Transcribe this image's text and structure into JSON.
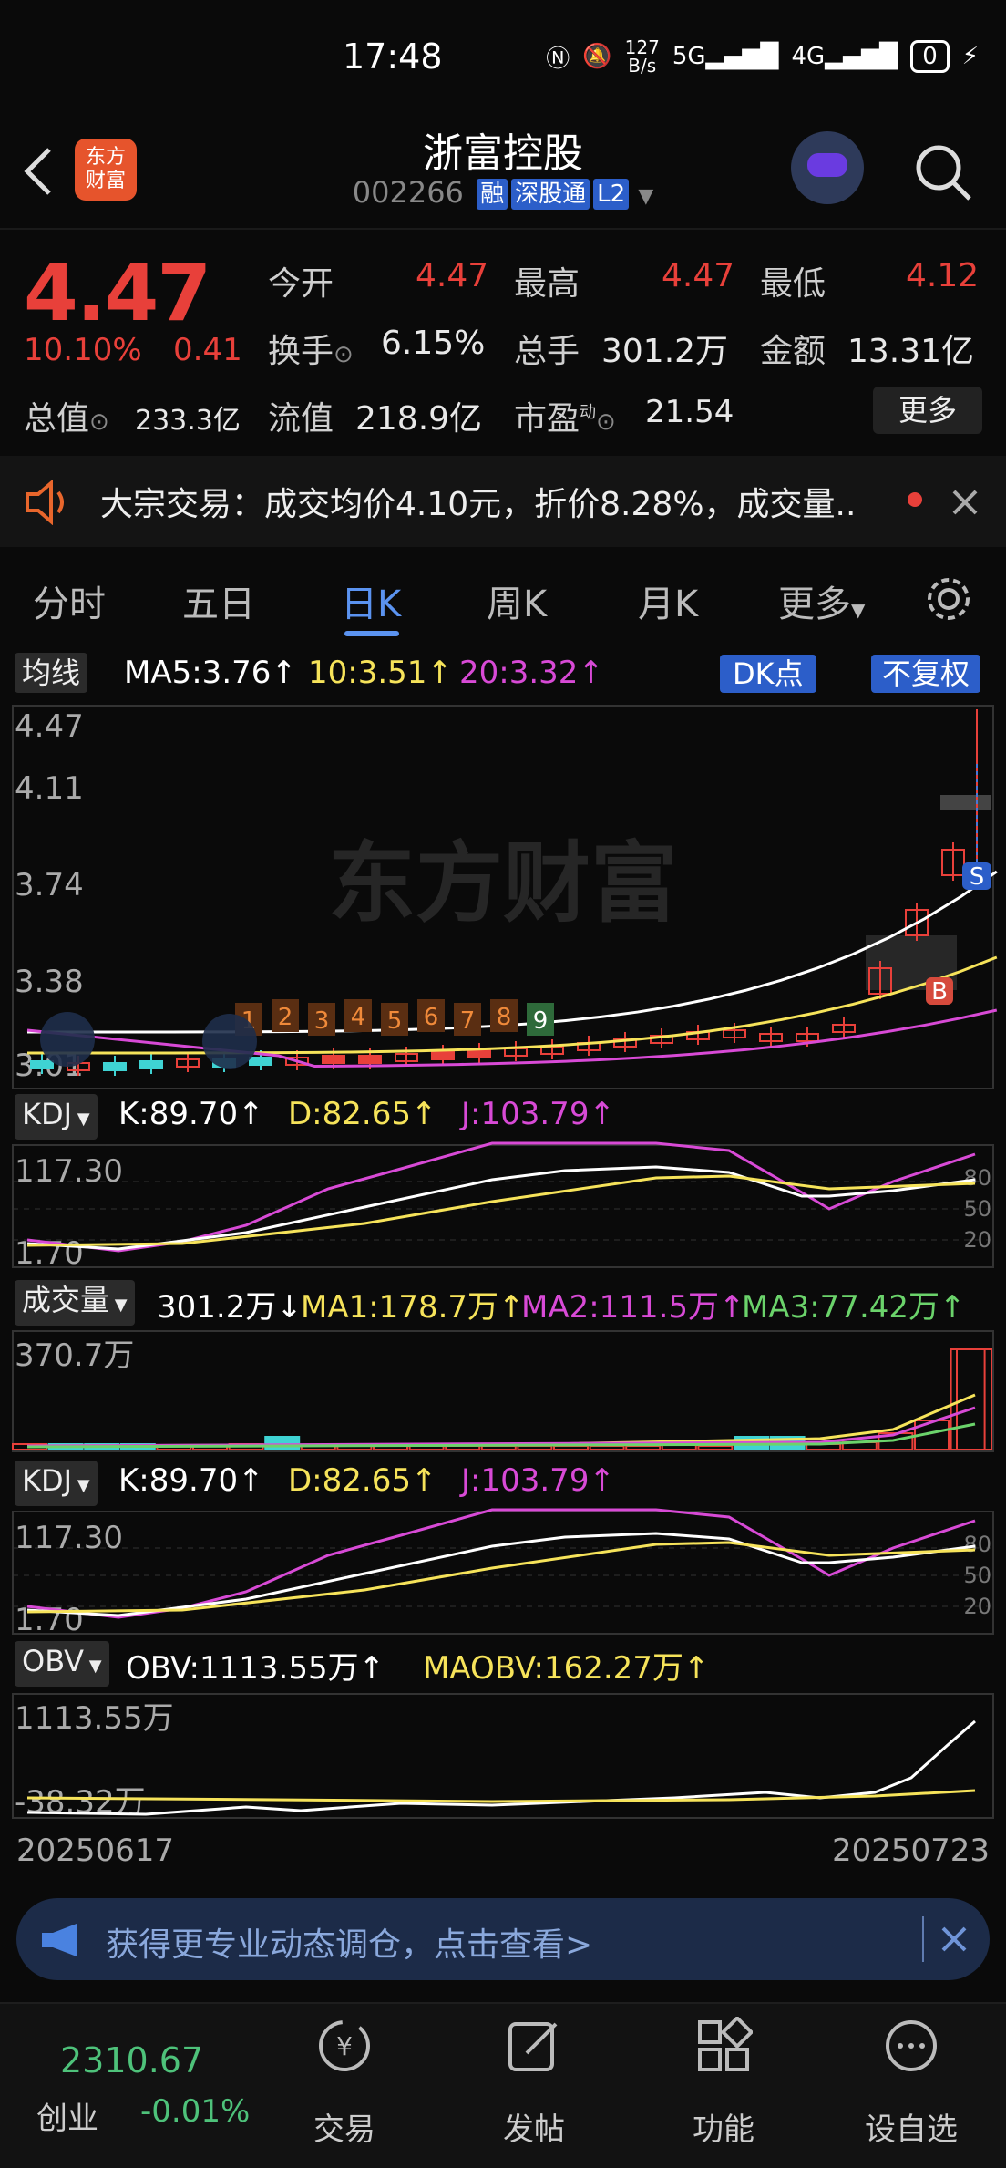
{
  "status": {
    "time": "17:48",
    "net_speed": "127\nB/s",
    "battery": "0"
  },
  "header": {
    "brand_logo": "东方\n财富",
    "stock_name": "浙富控股",
    "stock_code": "002266",
    "tags": [
      "融",
      "深股通",
      "L2"
    ]
  },
  "quote": {
    "price": "4.47",
    "change_pct": "10.10%",
    "change_amt": "0.41",
    "open_label": "今开",
    "open": "4.47",
    "high_label": "最高",
    "high": "4.47",
    "low_label": "最低",
    "low": "4.12",
    "turnover_label": "换手",
    "turnover": "6.15%",
    "volume_label": "总手",
    "volume": "301.2万",
    "amount_label": "金额",
    "amount": "13.31亿",
    "mktcap_label": "总值",
    "mktcap": "233.3亿",
    "float_label": "流值",
    "float_val": "218.9亿",
    "pe_label": "市盈",
    "pe_sup": "动",
    "pe": "21.54",
    "more_label": "更多"
  },
  "notice": {
    "text": "大宗交易：成交均价4.10元，折价8.28%，成交量.."
  },
  "tabs": [
    "分时",
    "五日",
    "日K",
    "周K",
    "月K",
    "更多"
  ],
  "active_tab": "日K",
  "ma_bar": {
    "label": "均线",
    "ma5": "MA5:3.76↑",
    "ma10": "10:3.51↑",
    "ma20": "20:3.32↑",
    "dk_label": "DK点",
    "fq_label": "不复权"
  },
  "watermark": "东方财富",
  "kline": {
    "y_labels": [
      "4.47",
      "4.11",
      "3.74",
      "3.38",
      "3.01"
    ],
    "nine_count": [
      "1",
      "2",
      "3",
      "4",
      "5",
      "6",
      "7",
      "8",
      "9"
    ],
    "b_mark": "B",
    "s_mark": "S"
  },
  "kdj1": {
    "label": "KDJ",
    "k": "K:89.70↑",
    "d": "D:82.65↑",
    "j": "J:103.79↑",
    "top": "117.30",
    "bottom": "1.70",
    "levels": [
      "80",
      "50",
      "20"
    ]
  },
  "volume": {
    "label": "成交量",
    "val": "301.2万↓",
    "ma1": "MA1:178.7万↑",
    "ma2": "MA2:111.5万↑",
    "ma3": "MA3:77.42万↑",
    "top": "370.7万"
  },
  "kdj2": {
    "label": "KDJ",
    "k": "K:89.70↑",
    "d": "D:82.65↑",
    "j": "J:103.79↑",
    "top": "117.30",
    "bottom": "1.70",
    "levels": [
      "80",
      "50",
      "20"
    ]
  },
  "obv": {
    "label": "OBV",
    "obv": "OBV:1113.55万↑",
    "maobv": "MAOBV:162.27万↑",
    "top": "1113.55万",
    "bottom": "-38.32万"
  },
  "dates": {
    "start": "20250617",
    "end": "20250723"
  },
  "banner": {
    "text": "获得更专业动态调仓，点击查看>"
  },
  "bottom": {
    "index_value": "2310.67",
    "index_name": "创业",
    "index_chg": "-0.01%",
    "items": [
      "交易",
      "发帖",
      "功能",
      "设自选"
    ]
  },
  "colors": {
    "up": "#e8403a",
    "down": "#3fd3d3",
    "ma5": "#ffffff",
    "ma10": "#f6e35a",
    "ma20": "#d84ad6",
    "ma3": "#6bd36b",
    "accent": "#5b93f0"
  }
}
